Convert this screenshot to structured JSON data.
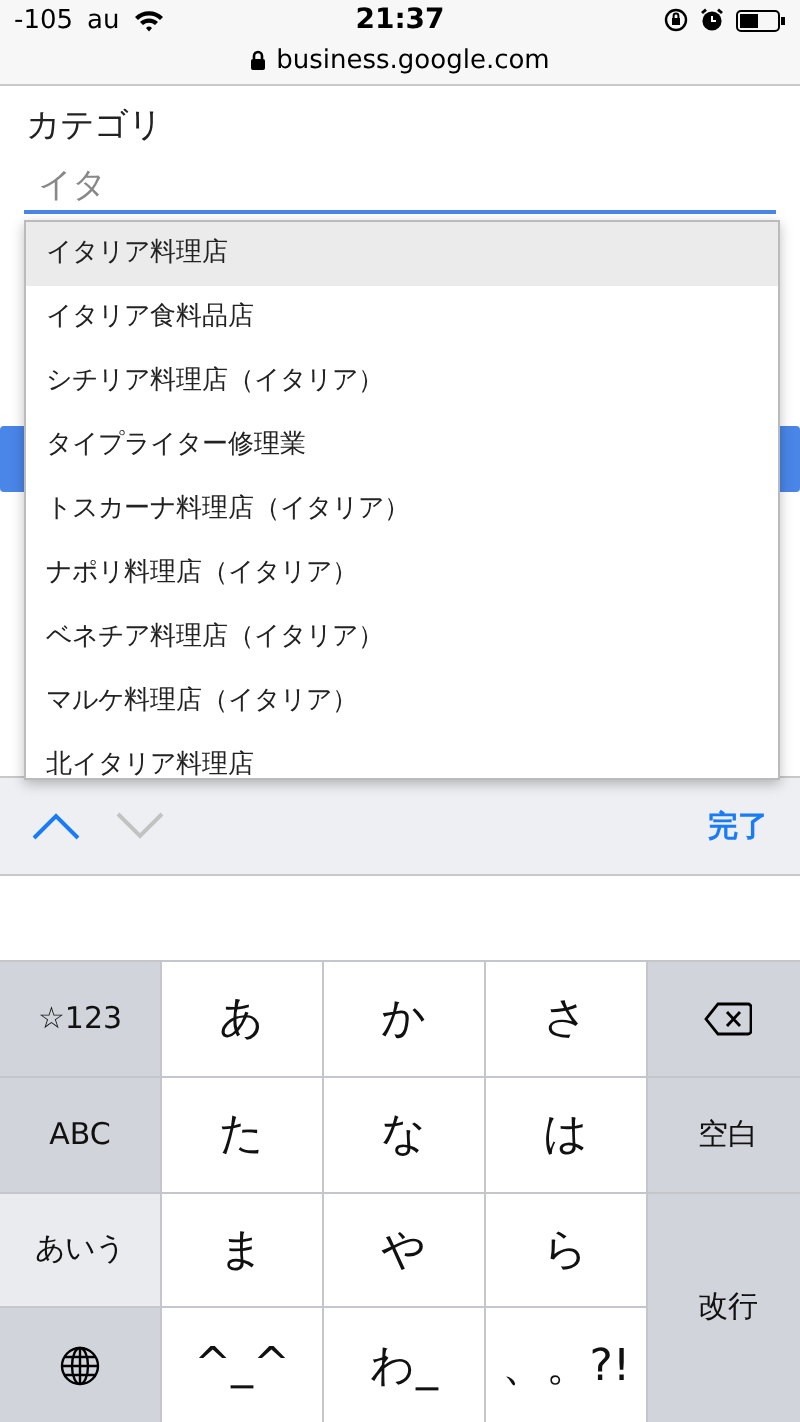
{
  "status_bar": {
    "signal": "-105",
    "carrier": "au",
    "time": "21:37"
  },
  "address_bar": {
    "url": "business.google.com"
  },
  "form": {
    "label": "カテゴリ",
    "value": "イタ"
  },
  "suggestions": [
    {
      "text": "イタリア料理店",
      "selected": true
    },
    {
      "text": "イタリア食料品店",
      "selected": false
    },
    {
      "text": "シチリア料理店（イタリア）",
      "selected": false
    },
    {
      "text": "タイプライター修理業",
      "selected": false
    },
    {
      "text": "トスカーナ料理店（イタリア）",
      "selected": false
    },
    {
      "text": "ナポリ料理店（イタリア）",
      "selected": false
    },
    {
      "text": "ベネチア料理店（イタリア）",
      "selected": false
    },
    {
      "text": "マルケ料理店（イタリア）",
      "selected": false
    },
    {
      "text": "北イタリア料理店",
      "selected": false
    }
  ],
  "toolbar": {
    "previous_disabled": false,
    "next_disabled": true,
    "done": "完了"
  },
  "keys": [
    {
      "kind": "function",
      "label": "☆123"
    },
    {
      "kind": "letter",
      "label": "あ"
    },
    {
      "kind": "letter",
      "label": "か"
    },
    {
      "kind": "letter",
      "label": "さ"
    },
    {
      "kind": "backspace"
    },
    {
      "kind": "function",
      "label": "ABC"
    },
    {
      "kind": "letter",
      "label": "た"
    },
    {
      "kind": "letter",
      "label": "な"
    },
    {
      "kind": "letter",
      "label": "は"
    },
    {
      "kind": "function",
      "label": "空白"
    },
    {
      "kind": "active",
      "label": "あいう"
    },
    {
      "kind": "letter",
      "label": "ま"
    },
    {
      "kind": "letter",
      "label": "や"
    },
    {
      "kind": "letter",
      "label": "ら"
    },
    {
      "kind": "return",
      "label": "改行"
    },
    {
      "kind": "globe"
    },
    {
      "kind": "letter",
      "label": "^_^"
    },
    {
      "kind": "letter",
      "label": "わ_"
    },
    {
      "kind": "letter",
      "label": "、。?!"
    }
  ]
}
